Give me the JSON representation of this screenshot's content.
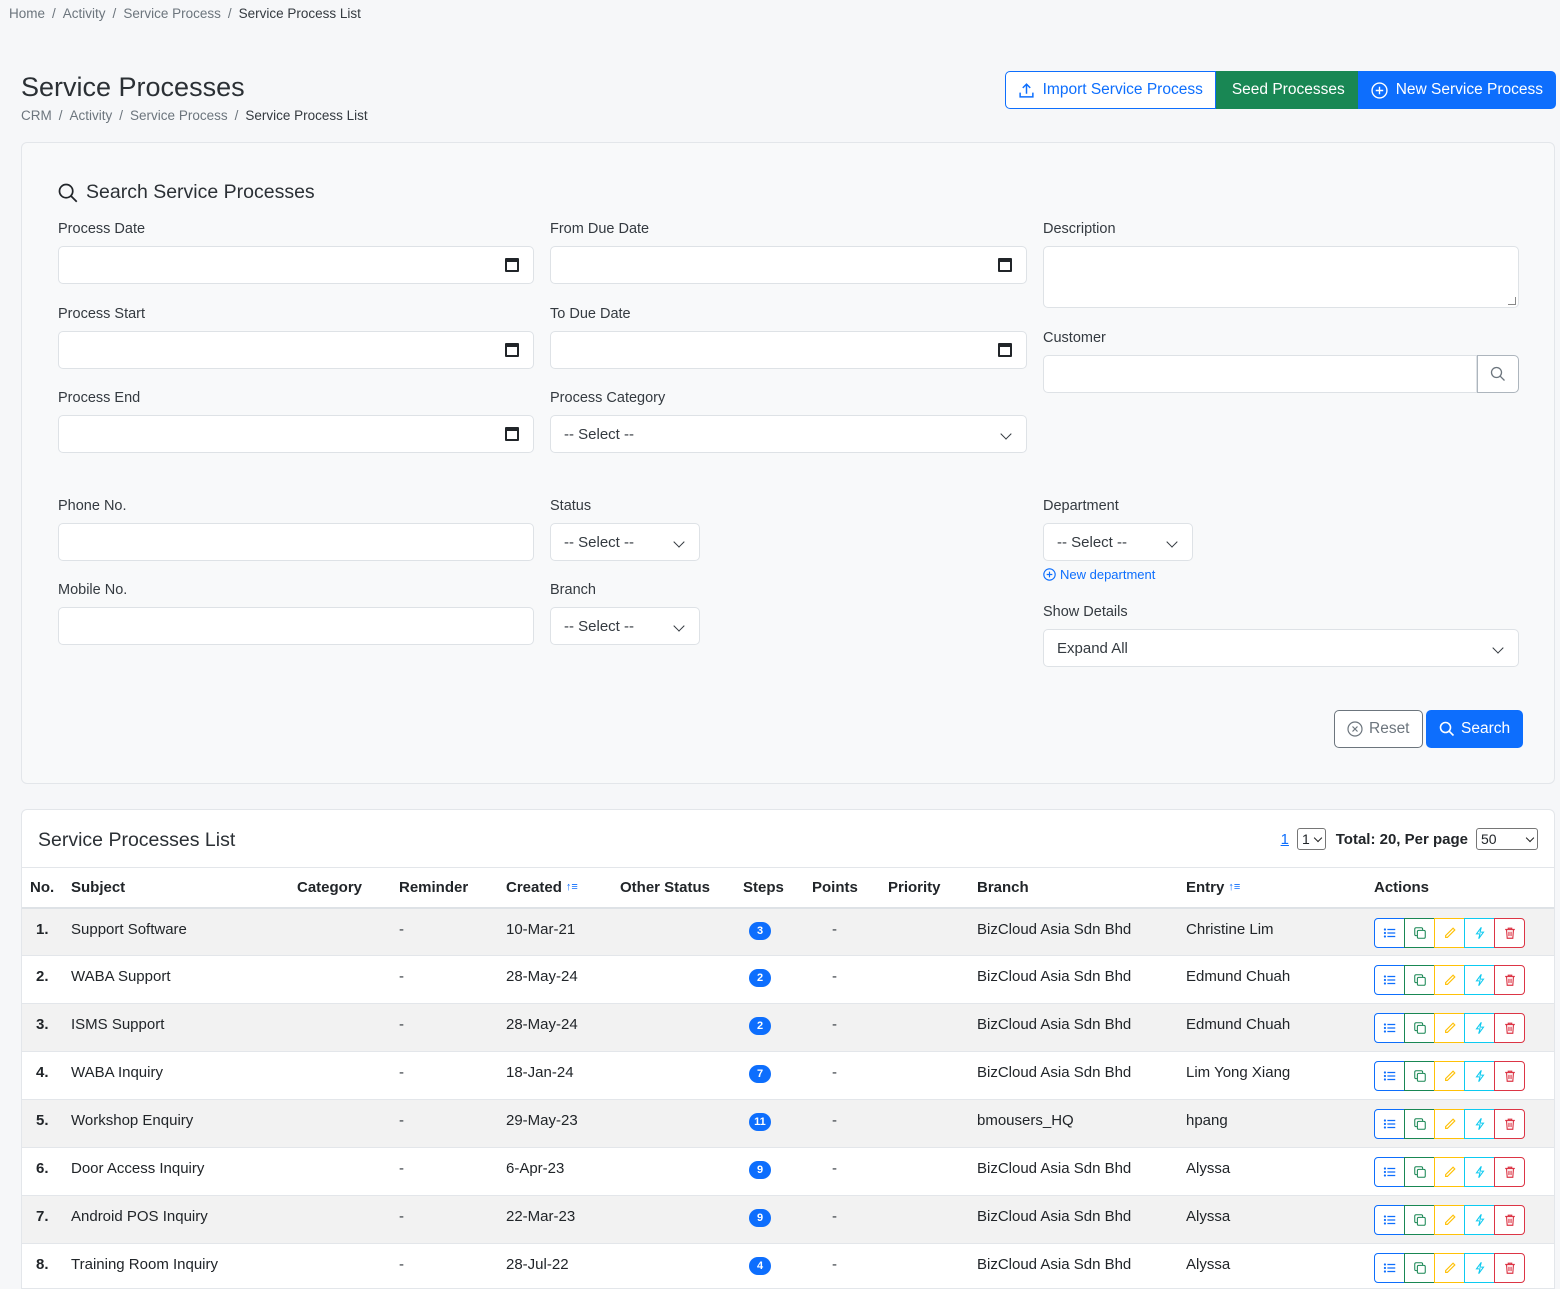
{
  "breadcrumb_top": [
    "Home",
    "Activity",
    "Service Process",
    "Service Process List"
  ],
  "page_title": "Service Processes",
  "breadcrumb_sub": [
    "CRM",
    "Activity",
    "Service Process",
    "Service Process List"
  ],
  "header_actions": {
    "import_label": "Import Service Process",
    "seed_label": "Seed Processes",
    "new_label": "New Service Process"
  },
  "search": {
    "heading": "Search Service Processes",
    "process_date": "Process Date",
    "from_due_date": "From Due Date",
    "description": "Description",
    "process_start": "Process Start",
    "to_due_date": "To Due Date",
    "customer": "Customer",
    "process_end": "Process End",
    "process_category": "Process Category",
    "process_category_value": "-- Select --",
    "phone_no": "Phone No.",
    "status": "Status",
    "status_value": "-- Select --",
    "department": "Department",
    "department_value": "-- Select --",
    "new_department": "New department",
    "mobile_no": "Mobile No.",
    "branch": "Branch",
    "branch_value": "-- Select --",
    "show_details": "Show Details",
    "show_details_value": "Expand All",
    "reset_label": "Reset",
    "search_label": "Search"
  },
  "list": {
    "heading": "Service Processes List",
    "page_link": "1",
    "page_select": "1",
    "total_text": "Total: 20, Per page",
    "per_page": "50",
    "columns": [
      "No.",
      "Subject",
      "Category",
      "Reminder",
      "Created",
      "Other Status",
      "Steps",
      "Points",
      "Priority",
      "Branch",
      "Entry",
      "Actions"
    ],
    "rows": [
      {
        "no": "1.",
        "subject": "Support Software",
        "category": "",
        "reminder": "-",
        "created": "10-Mar-21",
        "other_status": "",
        "steps": "3",
        "points": "-",
        "priority": "",
        "branch": "BizCloud Asia Sdn Bhd",
        "entry": "Christine Lim"
      },
      {
        "no": "2.",
        "subject": "WABA Support",
        "category": "",
        "reminder": "-",
        "created": "28-May-24",
        "other_status": "",
        "steps": "2",
        "points": "-",
        "priority": "",
        "branch": "BizCloud Asia Sdn Bhd",
        "entry": "Edmund Chuah"
      },
      {
        "no": "3.",
        "subject": "ISMS Support",
        "category": "",
        "reminder": "-",
        "created": "28-May-24",
        "other_status": "",
        "steps": "2",
        "points": "-",
        "priority": "",
        "branch": "BizCloud Asia Sdn Bhd",
        "entry": "Edmund Chuah"
      },
      {
        "no": "4.",
        "subject": "WABA Inquiry",
        "category": "",
        "reminder": "-",
        "created": "18-Jan-24",
        "other_status": "",
        "steps": "7",
        "points": "-",
        "priority": "",
        "branch": "BizCloud Asia Sdn Bhd",
        "entry": "Lim Yong Xiang"
      },
      {
        "no": "5.",
        "subject": "Workshop Enquiry",
        "category": "",
        "reminder": "-",
        "created": "29-May-23",
        "other_status": "",
        "steps": "11",
        "points": "-",
        "priority": "",
        "branch": "bmousers_HQ",
        "entry": "hpang"
      },
      {
        "no": "6.",
        "subject": "Door Access Inquiry",
        "category": "",
        "reminder": "-",
        "created": "6-Apr-23",
        "other_status": "",
        "steps": "9",
        "points": "-",
        "priority": "",
        "branch": "BizCloud Asia Sdn Bhd",
        "entry": "Alyssa"
      },
      {
        "no": "7.",
        "subject": "Android POS Inquiry",
        "category": "",
        "reminder": "-",
        "created": "22-Mar-23",
        "other_status": "",
        "steps": "9",
        "points": "-",
        "priority": "",
        "branch": "BizCloud Asia Sdn Bhd",
        "entry": "Alyssa"
      },
      {
        "no": "8.",
        "subject": "Training Room Inquiry",
        "category": "",
        "reminder": "-",
        "created": "28-Jul-22",
        "other_status": "",
        "steps": "4",
        "points": "-",
        "priority": "",
        "branch": "BizCloud Asia Sdn Bhd",
        "entry": "Alyssa"
      }
    ]
  }
}
